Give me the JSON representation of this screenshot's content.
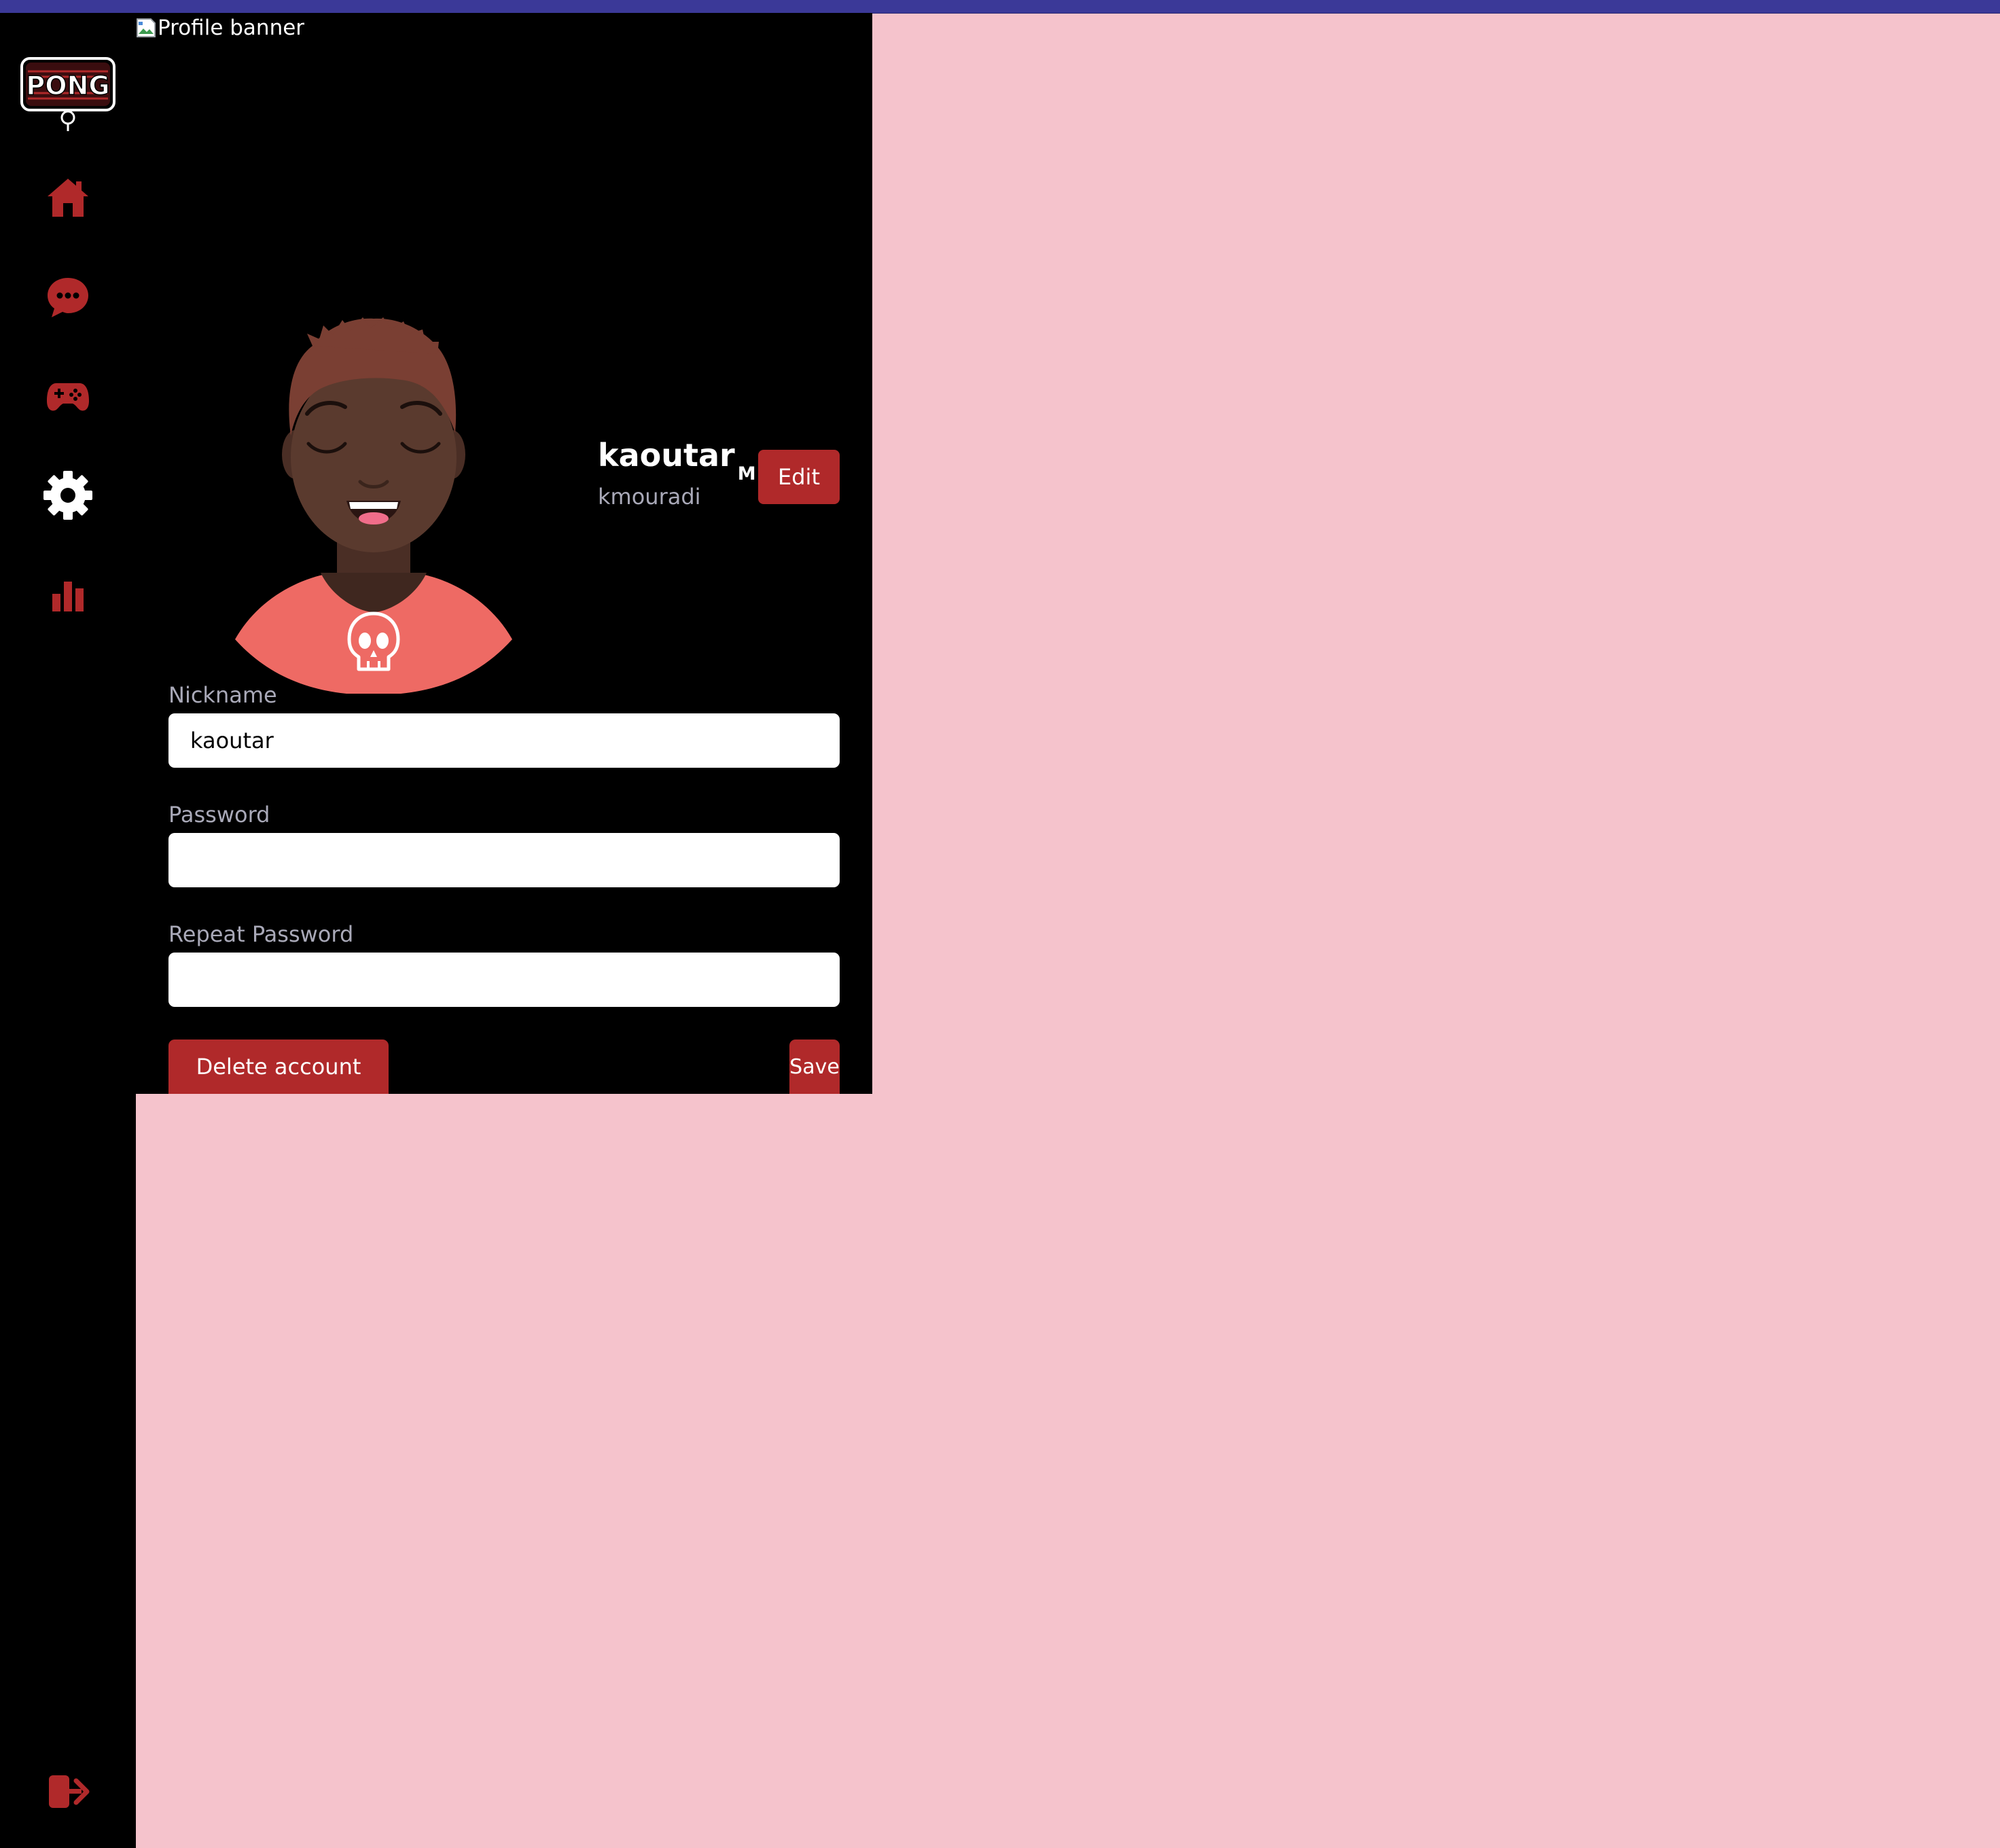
{
  "app": {
    "logo_text": "PONG"
  },
  "sidebar": {
    "items": [
      {
        "name": "home",
        "icon": "home-icon",
        "active": false
      },
      {
        "name": "chat",
        "icon": "chat-icon",
        "active": false
      },
      {
        "name": "game",
        "icon": "gamepad-icon",
        "active": false
      },
      {
        "name": "settings",
        "icon": "gear-icon",
        "active": true
      },
      {
        "name": "leaderboard",
        "icon": "bar-chart-icon",
        "active": false
      }
    ],
    "logout_icon": "logout-icon"
  },
  "profile": {
    "banner_alt": "Profile banner",
    "display_name": "kaoutar",
    "gender_badge": "M",
    "username": "kmouradi",
    "edit_label": "Edit"
  },
  "form": {
    "nickname_label": "Nickname",
    "nickname_value": "kaoutar",
    "password_label": "Password",
    "password_value": "",
    "repeat_password_label": "Repeat Password",
    "repeat_password_value": "",
    "delete_label": "Delete account",
    "save_label": "Save"
  },
  "colors": {
    "accent": "#b0292a",
    "page_background": "#f5c3cc",
    "panel_background": "#000000",
    "top_strip": "#3b3998",
    "muted_text": "#a9a9b8"
  }
}
